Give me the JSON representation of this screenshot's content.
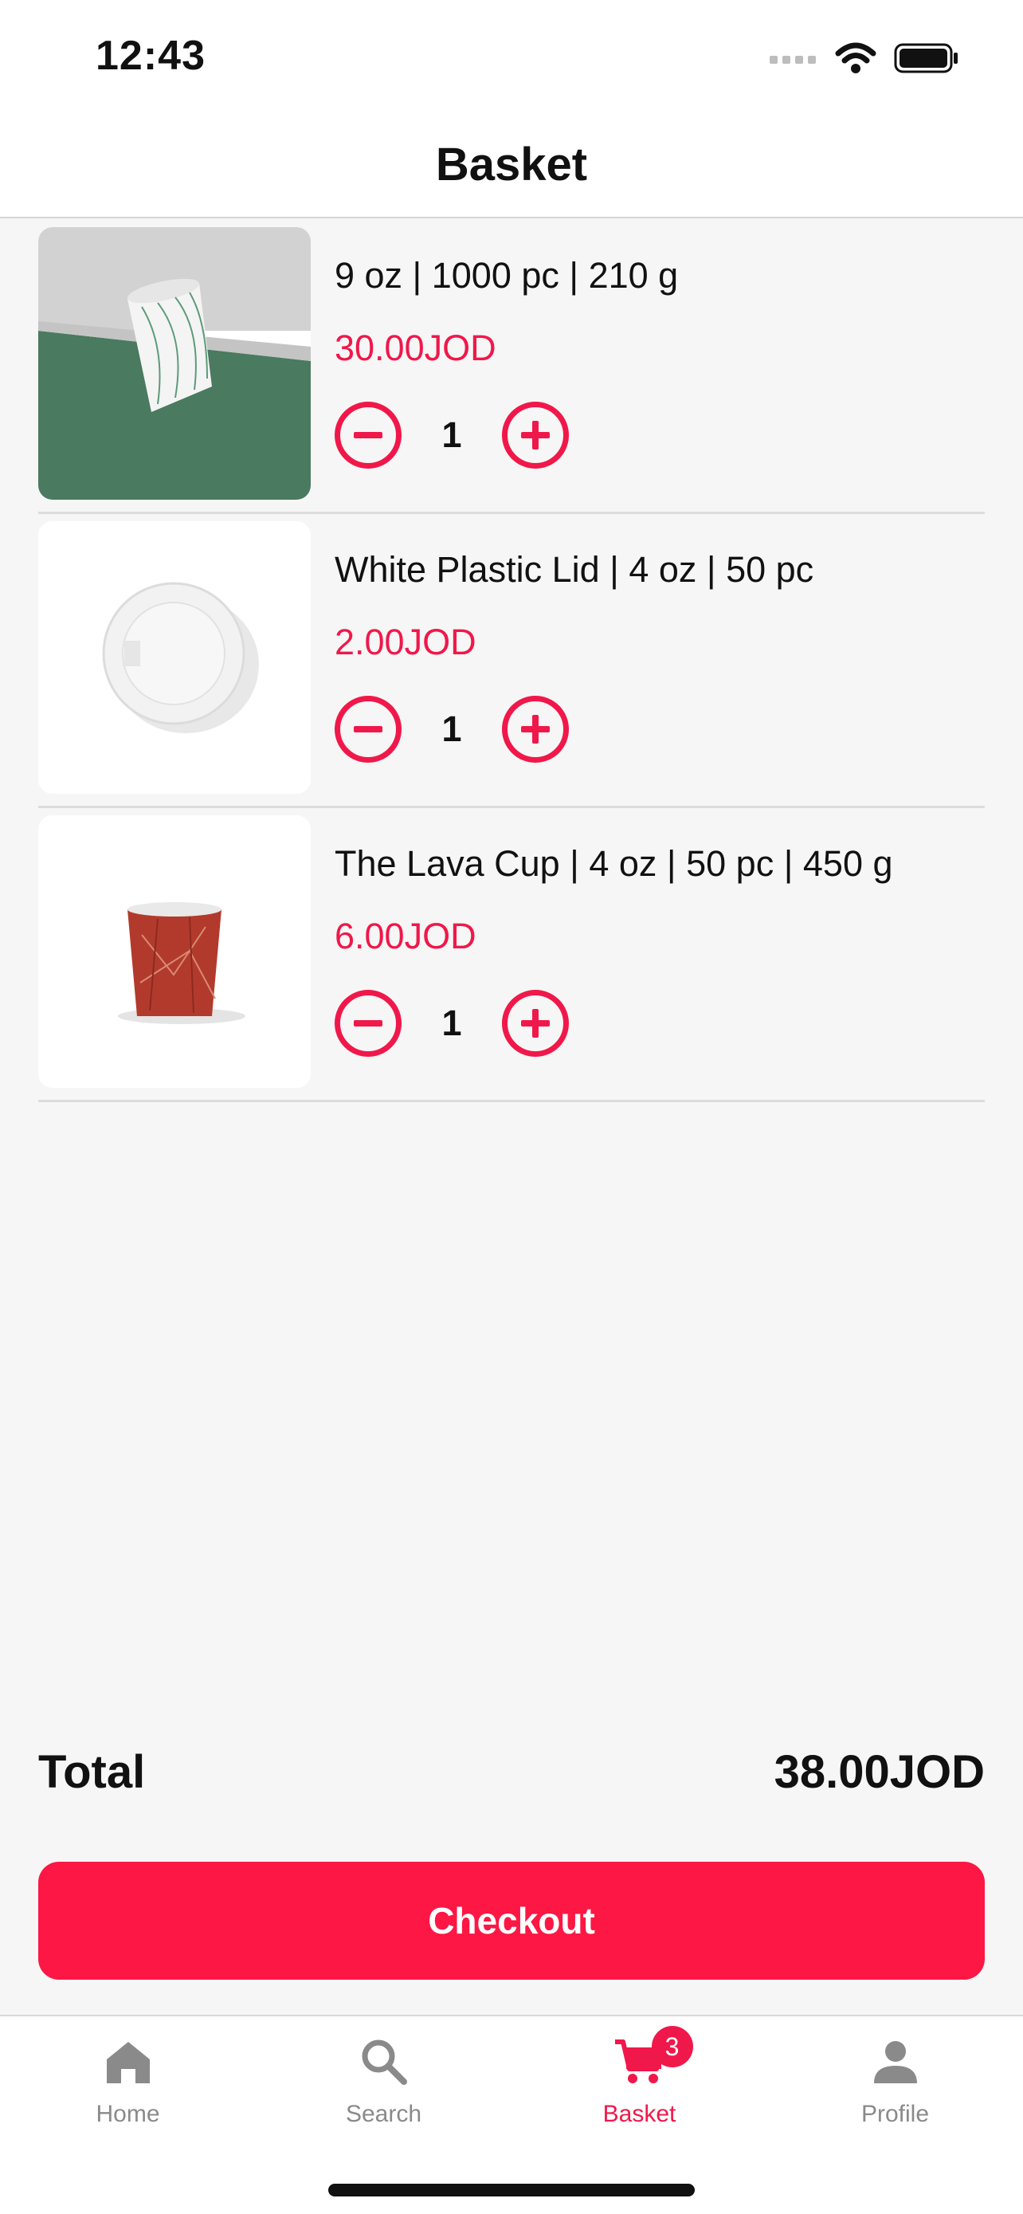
{
  "status_bar": {
    "time": "12:43"
  },
  "header": {
    "title": "Basket"
  },
  "items": [
    {
      "name": "9 oz | 1000 pc | 210 g",
      "price": "30.00JOD",
      "quantity": "1",
      "image": "white-paper-cup-on-green"
    },
    {
      "name": "White Plastic Lid | 4 oz | 50 pc",
      "price": "2.00JOD",
      "quantity": "1",
      "image": "white-plastic-lid"
    },
    {
      "name": "The Lava Cup | 4 oz | 50 pc | 450 g",
      "price": "6.00JOD",
      "quantity": "1",
      "image": "red-lava-cup"
    }
  ],
  "summary": {
    "total_label": "Total",
    "total_value": "38.00JOD"
  },
  "checkout": {
    "label": "Checkout"
  },
  "tab_bar": {
    "tabs": [
      {
        "label": "Home",
        "icon": "home-icon",
        "active": false
      },
      {
        "label": "Search",
        "icon": "search-icon",
        "active": false
      },
      {
        "label": "Basket",
        "icon": "cart-icon",
        "active": true,
        "badge": "3"
      },
      {
        "label": "Profile",
        "icon": "profile-icon",
        "active": false
      }
    ]
  },
  "colors": {
    "accent": "#f0184a",
    "checkout": "#fd1744",
    "background": "#f6f6f6",
    "inactive": "#8a8a8a"
  }
}
